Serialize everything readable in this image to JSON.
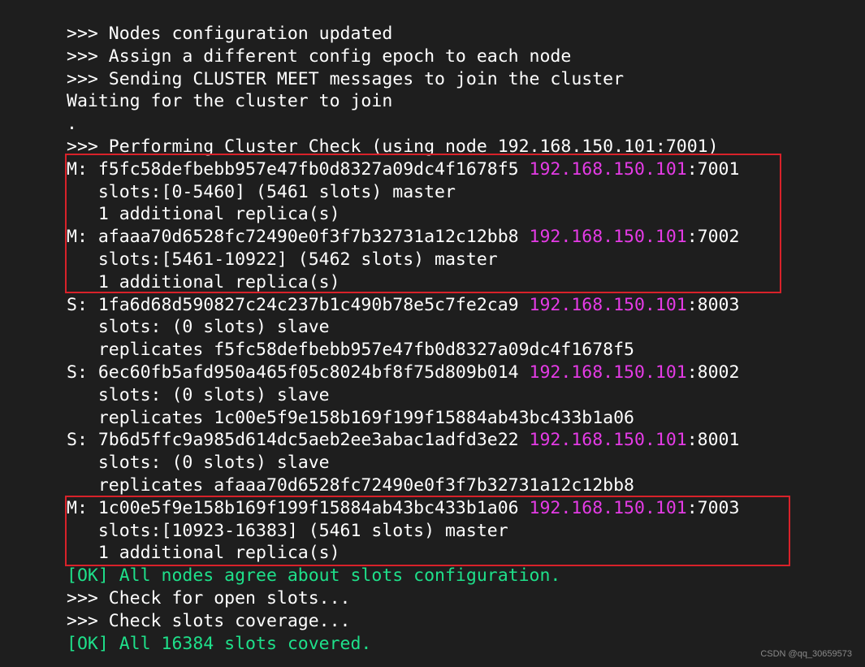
{
  "lines": [
    {
      "text": ">>> Nodes configuration updated"
    },
    {
      "text": ">>> Assign a different config epoch to each node"
    },
    {
      "text": ">>> Sending CLUSTER MEET messages to join the cluster"
    },
    {
      "text": "Waiting for the cluster to join"
    },
    {
      "text": "."
    },
    {
      "text": ">>> Performing Cluster Check (using node 192.168.150.101:7001)"
    },
    {
      "text": "M: f5fc58defbebb957e47fb0d8327a09dc4f1678f5 ",
      "ip": "192.168.150.101",
      "port": ":7001"
    },
    {
      "text": "   slots:[0-5460] (5461 slots) master"
    },
    {
      "text": "   1 additional replica(s)"
    },
    {
      "text": "M: afaaa70d6528fc72490e0f3f7b32731a12c12bb8 ",
      "ip": "192.168.150.101",
      "port": ":7002"
    },
    {
      "text": "   slots:[5461-10922] (5462 slots) master"
    },
    {
      "text": "   1 additional replica(s)"
    },
    {
      "text": "S: 1fa6d68d590827c24c237b1c490b78e5c7fe2ca9 ",
      "ip": "192.168.150.101",
      "port": ":8003"
    },
    {
      "text": "   slots: (0 slots) slave"
    },
    {
      "text": "   replicates f5fc58defbebb957e47fb0d8327a09dc4f1678f5"
    },
    {
      "text": "S: 6ec60fb5afd950a465f05c8024bf8f75d809b014 ",
      "ip": "192.168.150.101",
      "port": ":8002"
    },
    {
      "text": "   slots: (0 slots) slave"
    },
    {
      "text": "   replicates 1c00e5f9e158b169f199f15884ab43bc433b1a06"
    },
    {
      "text": "S: 7b6d5ffc9a985d614dc5aeb2ee3abac1adfd3e22 ",
      "ip": "192.168.150.101",
      "port": ":8001"
    },
    {
      "text": "   slots: (0 slots) slave"
    },
    {
      "text": "   replicates afaaa70d6528fc72490e0f3f7b32731a12c12bb8"
    },
    {
      "text": "M: 1c00e5f9e158b169f199f15884ab43bc433b1a06 ",
      "ip": "192.168.150.101",
      "port": ":7003"
    },
    {
      "text": "   slots:[10923-16383] (5461 slots) master"
    },
    {
      "text": "   1 additional replica(s)"
    },
    {
      "text": "[OK] All nodes agree about slots configuration.",
      "ok": true
    },
    {
      "text": ">>> Check for open slots..."
    },
    {
      "text": ">>> Check slots coverage..."
    },
    {
      "text": "[OK] All 16384 slots covered.",
      "ok": true
    }
  ],
  "colors": {
    "background": "#1e1e1e",
    "text": "#ffffff",
    "ok": "#1ee08a",
    "ip": "#e53be6",
    "highlight_box": "#d8222a"
  },
  "watermark": "CSDN @qq_30659573"
}
